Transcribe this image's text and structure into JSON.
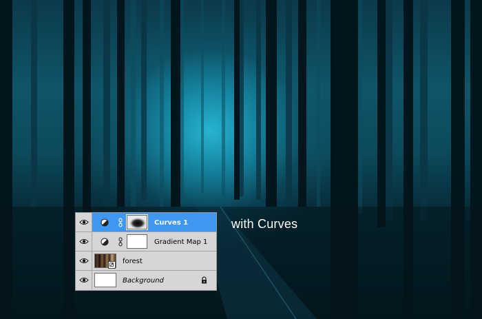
{
  "caption": "with Curves",
  "layers_panel": {
    "layers": [
      {
        "name": "Curves 1",
        "type": "adjustment",
        "selected": true,
        "visible": true,
        "has_mask": true,
        "mask_thumbnail": "dark-vignette-mask"
      },
      {
        "name": "Gradient Map 1",
        "type": "adjustment",
        "selected": false,
        "visible": true,
        "has_mask": true,
        "mask_thumbnail": "white-mask"
      },
      {
        "name": "forest",
        "type": "smart-object",
        "selected": false,
        "visible": true
      },
      {
        "name": "Background",
        "type": "background",
        "selected": false,
        "visible": true,
        "locked": true
      }
    ],
    "icons": {
      "visibility": "eye-icon",
      "adjustment": "adjustment-layer-icon",
      "link": "chain-link-icon",
      "smart_object": "smart-object-badge-icon",
      "lock": "lock-icon"
    }
  },
  "colors": {
    "selected_row": "#3f97f0",
    "panel_bg": "#d6d6d6",
    "scene_glow": "#28b9d7"
  }
}
